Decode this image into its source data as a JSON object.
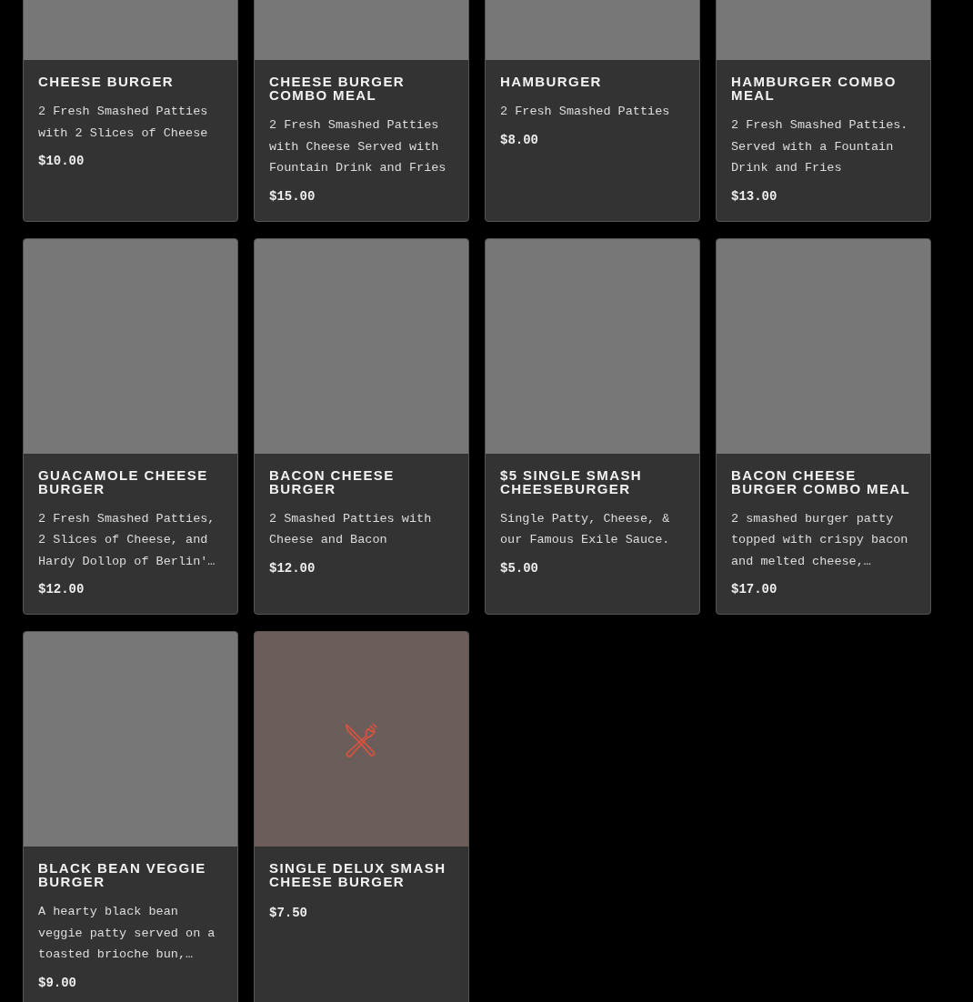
{
  "menu_items": [
    {
      "name": "CHEESE BURGER",
      "description": "2 Fresh Smashed Patties with 2 Slices of Cheese",
      "price": "$10.00"
    },
    {
      "name": "CHEESE BURGER COMBO MEAL",
      "description": "2 Fresh Smashed Patties with Cheese Served with Fountain Drink and Fries",
      "price": "$15.00"
    },
    {
      "name": "HAMBURGER",
      "description": "2 Fresh Smashed Patties",
      "price": "$8.00"
    },
    {
      "name": "HAMBURGER COMBO MEAL",
      "description": "2 Fresh Smashed Patties. Served with a Fountain Drink and Fries",
      "price": "$13.00"
    },
    {
      "name": "GUACAMOLE CHEESE BURGER",
      "description": "2 Fresh Smashed Patties, 2 Slices of Cheese, and Hardy Dollop of Berlin'…",
      "price": "$12.00"
    },
    {
      "name": "BACON CHEESE BURGER",
      "description": "2 Smashed Patties with Cheese and Bacon",
      "price": "$12.00"
    },
    {
      "name": "$5 SINGLE SMASH CHEESEBURGER",
      "description": "Single Patty, Cheese, & our Famous Exile Sauce.",
      "price": "$5.00"
    },
    {
      "name": "BACON CHEESE BURGER COMBO MEAL",
      "description": "2 smashed burger patty topped with crispy bacon and melted cheese,…",
      "price": "$17.00"
    },
    {
      "name": "BLACK BEAN VEGGIE BURGER",
      "description": "A hearty black bean veggie patty served on a toasted brioche bun,…",
      "price": "$9.00"
    },
    {
      "kind": "fallback",
      "name": "SINGLE DELUX SMASH CHEESE BURGER",
      "price": "$7.50"
    }
  ]
}
